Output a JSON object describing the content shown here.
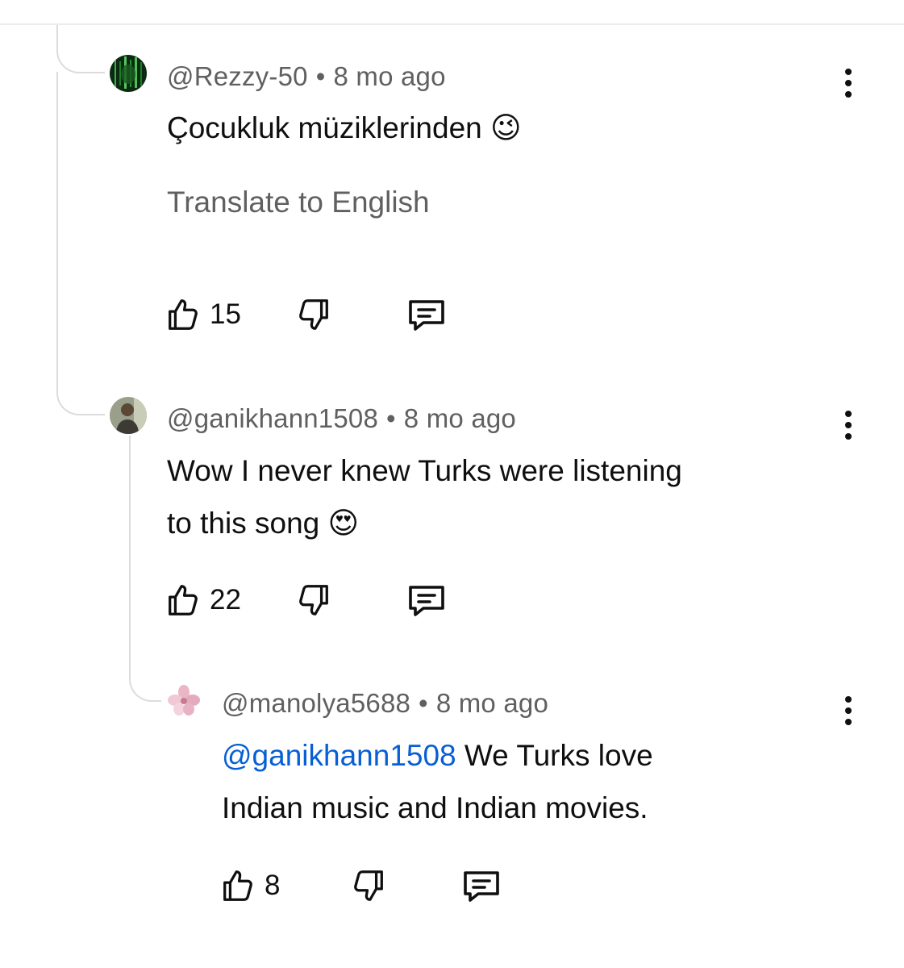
{
  "comments": [
    {
      "author": "@Rezzy-50",
      "separator": "•",
      "time": "8 mo ago",
      "text": "Çocukluk müziklerinden",
      "emoji": "😉",
      "translate_label": "Translate to English",
      "likes": "15",
      "avatar_icon": "matrix-avatar"
    },
    {
      "author": "@ganikhann1508",
      "separator": "•",
      "time": "8 mo ago",
      "text_line1": "Wow I never knew Turks were listening",
      "text_line2": "to this song",
      "emoji": "😍",
      "likes": "22",
      "avatar_icon": "person-photo-avatar"
    },
    {
      "author": "@manolya5688",
      "separator": "•",
      "time": "8 mo ago",
      "mention": "@ganikhann1508",
      "text_line1_rest": " We Turks love",
      "text_line2": "Indian music and Indian movies.",
      "likes": "8",
      "avatar_icon": "flower-avatar"
    }
  ],
  "colors": {
    "text": "#0f0f0f",
    "secondary": "#606060",
    "mention": "#065fd4",
    "thread_line": "#dcdcdc"
  }
}
